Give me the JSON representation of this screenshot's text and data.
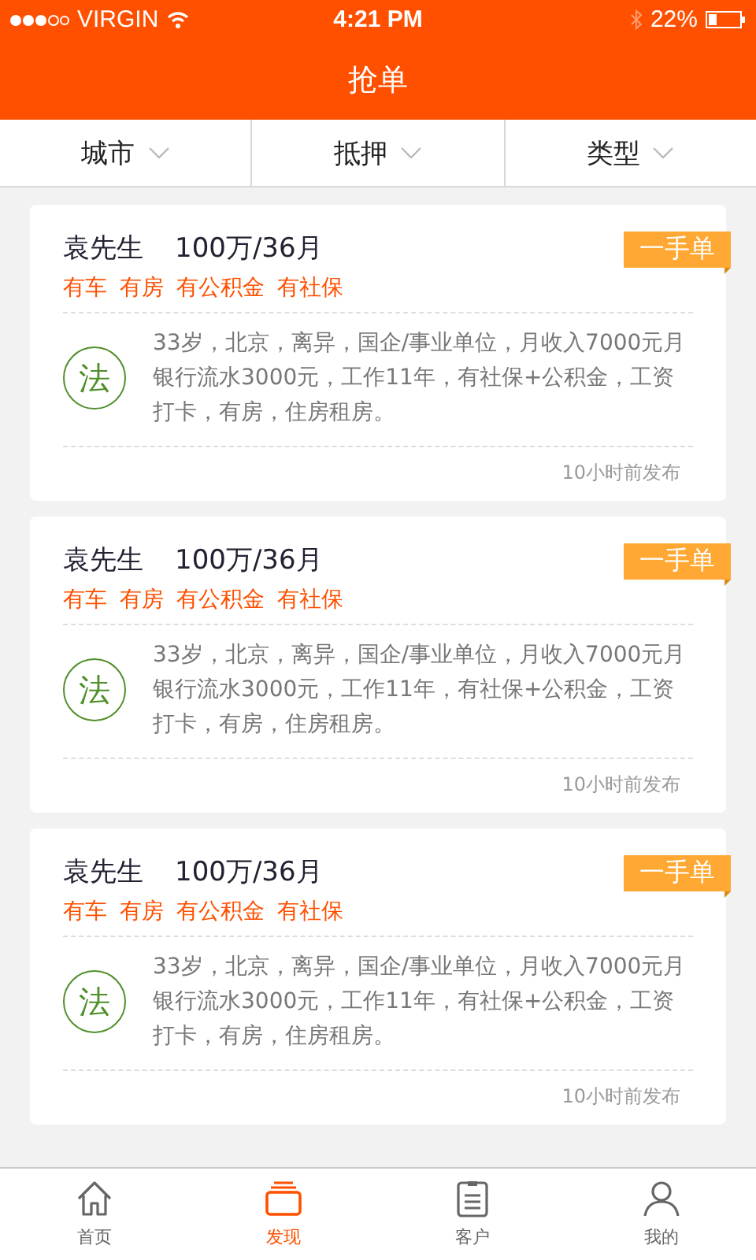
{
  "status_bar": {
    "carrier": "VIRGIN",
    "time": "4:21 PM",
    "battery": "22%"
  },
  "header": {
    "title": "抢单"
  },
  "filters": [
    {
      "label": "城市"
    },
    {
      "label": "抵押"
    },
    {
      "label": "类型"
    }
  ],
  "orders": [
    {
      "name": "袁先生",
      "amount": "100万/36月",
      "badge": "一手单",
      "tags": [
        "有车",
        "有房",
        "有公积金",
        "有社保"
      ],
      "type_mark": "法",
      "description": "33岁，北京，离异，国企/事业单位，月收入7000元月银行流水3000元，工作11年，有社保+公积金，工资打卡，有房，住房租房。",
      "posted": "10小时前发布"
    },
    {
      "name": "袁先生",
      "amount": "100万/36月",
      "badge": "一手单",
      "tags": [
        "有车",
        "有房",
        "有公积金",
        "有社保"
      ],
      "type_mark": "法",
      "description": "33岁，北京，离异，国企/事业单位，月收入7000元月银行流水3000元，工作11年，有社保+公积金，工资打卡，有房，住房租房。",
      "posted": "10小时前发布"
    },
    {
      "name": "袁先生",
      "amount": "100万/36月",
      "badge": "一手单",
      "tags": [
        "有车",
        "有房",
        "有公积金",
        "有社保"
      ],
      "type_mark": "法",
      "description": "33岁，北京，离异，国企/事业单位，月收入7000元月银行流水3000元，工作11年，有社保+公积金，工资打卡，有房，住房租房。",
      "posted": "10小时前发布"
    }
  ],
  "tab_bar": [
    {
      "kind": "home",
      "label": "首页",
      "selected": false
    },
    {
      "kind": "discover",
      "label": "发现",
      "selected": true
    },
    {
      "kind": "clients",
      "label": "客户",
      "selected": false
    },
    {
      "kind": "profile",
      "label": "我的",
      "selected": false
    }
  ]
}
